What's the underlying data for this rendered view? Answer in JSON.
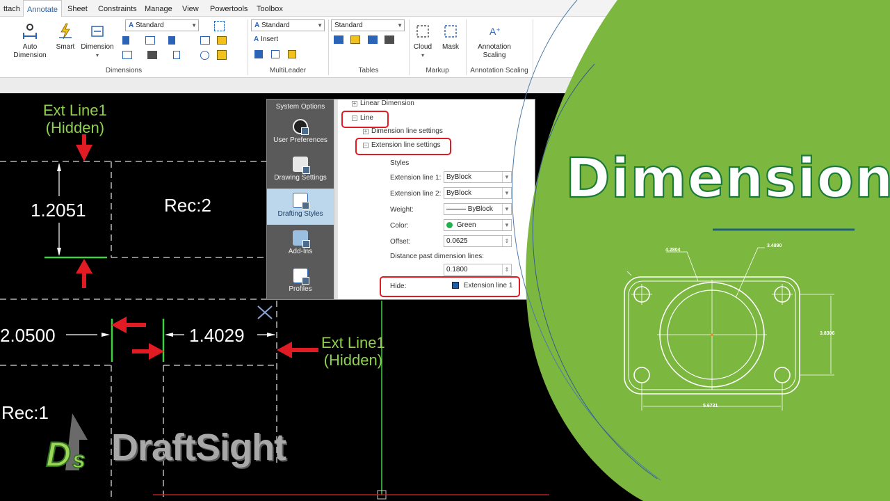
{
  "ribbon": {
    "tabs": [
      "ttach",
      "Annotate",
      "Sheet",
      "Constraints",
      "Manage",
      "View",
      "Powertools",
      "Toolbox"
    ],
    "active_tab": "Annotate",
    "auto_dimension": "Auto\nDimension",
    "auto_label_1": "Auto",
    "auto_label_2": "Dimension",
    "smart_label": "Smart",
    "dimension_label": "Dimension",
    "dim_style": "Standard",
    "multileader_style": "Standard",
    "insert_label": "Insert",
    "table_style": "Standard",
    "cloud_label": "Cloud",
    "mask_label": "Mask",
    "annotation_label_1": "Annotation",
    "annotation_label_2": "Scaling",
    "groups": {
      "dimensions": "Dimensions",
      "multileader": "MultiLeader",
      "tables": "Tables",
      "markup": "Markup",
      "annotation_scaling": "Annotation Scaling"
    }
  },
  "canvas": {
    "ext_line_top": [
      "Ext Line1",
      "(Hidden)"
    ],
    "ext_line_right": [
      "Ext Line1",
      "(Hidden)"
    ],
    "dim_vertical": "1.2051",
    "rec2": "Rec:2",
    "dim_left": "2.0500",
    "dim_mid": "1.4029",
    "rec1": "Rec:1"
  },
  "dialog": {
    "side_items": [
      "System Options",
      "User Preferences",
      "Drawing Settings",
      "Drafting Styles",
      "Add-Ins",
      "Profiles"
    ],
    "active_side": "Drafting Styles",
    "tree": {
      "linear_dimension": "Linear Dimension",
      "line": "Line",
      "dimension_line_settings": "Dimension line settings",
      "extension_line_settings": "Extension line settings",
      "styles": "Styles"
    },
    "props": {
      "ext1_label": "Extension line 1:",
      "ext1_value": "ByBlock",
      "ext2_label": "Extension line 2:",
      "ext2_value": "ByBlock",
      "weight_label": "Weight:",
      "weight_value": "ByBlock",
      "color_label": "Color:",
      "color_value": "Green",
      "offset_label": "Offset:",
      "offset_value": "0.0625",
      "distance_label": "Distance past dimension lines:",
      "distance_value": "0.1800",
      "hide_label": "Hide:",
      "hide_value": "Extension line 1"
    }
  },
  "panel": {
    "title": "Dimensions",
    "drawing_dims": {
      "d1": "4.2804",
      "d2": "3.4890",
      "d3": "3.8306",
      "d4": "5.6731"
    }
  },
  "logo": {
    "mark": "DS",
    "text": "DraftSight"
  },
  "colors": {
    "green_panel": "#7cb83f",
    "highlight_red": "#e01b24",
    "ext_line_green": "#8fd14f",
    "title_outline": "#1a7a3a",
    "rule_blue": "#1f5f7a"
  }
}
